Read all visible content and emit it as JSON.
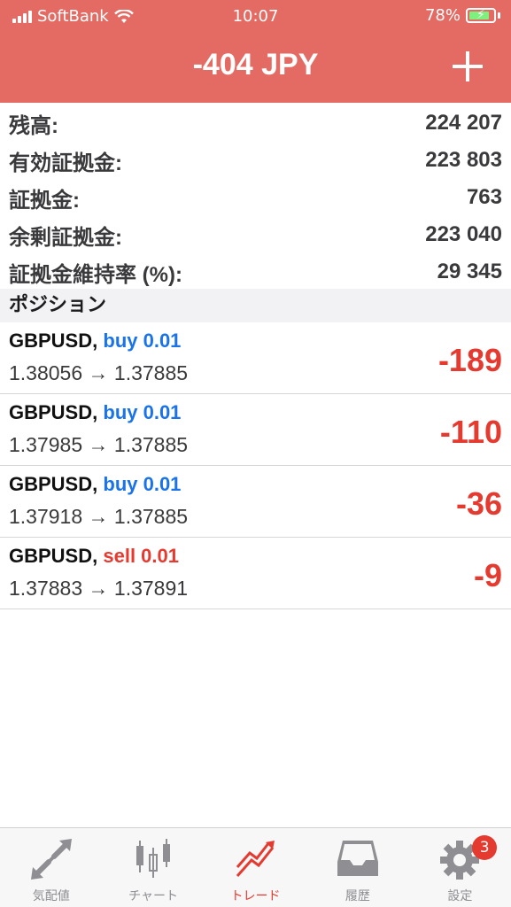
{
  "status_bar": {
    "carrier": "SoftBank",
    "time": "10:07",
    "battery": "78%"
  },
  "header": {
    "title": "-404 JPY"
  },
  "summary": [
    {
      "label": "残高:",
      "value": "224 207"
    },
    {
      "label": "有効証拠金:",
      "value": "223 803"
    },
    {
      "label": "証拠金:",
      "value": "763"
    },
    {
      "label": "余剰証拠金:",
      "value": "223 040"
    },
    {
      "label": "証拠金維持率 (%):",
      "value": "29 345"
    }
  ],
  "positions_header": "ポジション",
  "positions": [
    {
      "symbol": "GBPUSD,",
      "side": "buy 0.01",
      "prices": "1.38056 → 1.37885",
      "pnl": "-189"
    },
    {
      "symbol": "GBPUSD,",
      "side": "buy 0.01",
      "prices": "1.37985 → 1.37885",
      "pnl": "-110"
    },
    {
      "symbol": "GBPUSD,",
      "side": "buy 0.01",
      "prices": "1.37918 → 1.37885",
      "pnl": "-36"
    },
    {
      "symbol": "GBPUSD,",
      "side": "sell 0.01",
      "prices": "1.37883 → 1.37891",
      "pnl": "-9"
    }
  ],
  "tabs": [
    {
      "label": "気配値",
      "icon": "quotes-arrows-icon"
    },
    {
      "label": "チャート",
      "icon": "candlestick-chart-icon"
    },
    {
      "label": "トレード",
      "icon": "trade-trend-icon"
    },
    {
      "label": "履歴",
      "icon": "history-inbox-icon"
    },
    {
      "label": "設定",
      "icon": "settings-gear-icon",
      "badge": "3"
    }
  ],
  "colors": {
    "header": "#e46b63",
    "buy": "#1a73e8",
    "sell": "#e53a2f",
    "loss": "#e53a2f",
    "active_tab": "#e53a2f"
  }
}
